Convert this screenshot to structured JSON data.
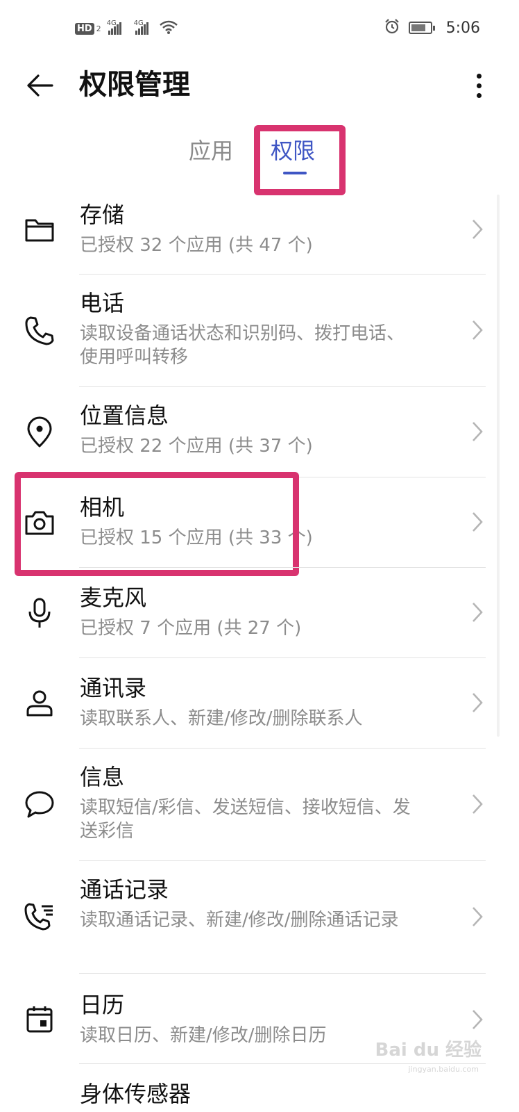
{
  "status_bar": {
    "hd_label": "HD",
    "hd_sub": "2",
    "network1": "4G",
    "network2": "4G",
    "time": "5:06"
  },
  "app_bar": {
    "title": "权限管理"
  },
  "tabs": [
    {
      "label": "应用",
      "selected": false
    },
    {
      "label": "权限",
      "selected": true
    }
  ],
  "accent_color": "#3f56c4",
  "highlight_color": "#d8336f",
  "permissions": [
    {
      "title": "存储",
      "subtitle": "已授权 32 个应用 (共 47 个)",
      "icon": "folder-icon"
    },
    {
      "title": "电话",
      "subtitle": "读取设备通话状态和识别码、拨打电话、使用呼叫转移",
      "icon": "phone-icon"
    },
    {
      "title": "位置信息",
      "subtitle": "已授权 22 个应用 (共 37 个)",
      "icon": "location-pin-icon"
    },
    {
      "title": "相机",
      "subtitle": "已授权 15 个应用 (共 33 个)",
      "icon": "camera-icon"
    },
    {
      "title": "麦克风",
      "subtitle": "已授权 7 个应用 (共 27 个)",
      "icon": "microphone-icon"
    },
    {
      "title": "通讯录",
      "subtitle": "读取联系人、新建/修改/删除联系人",
      "icon": "person-icon"
    },
    {
      "title": "信息",
      "subtitle": "读取短信/彩信、发送短信、接收短信、发送彩信",
      "icon": "chat-bubble-icon"
    },
    {
      "title": "通话记录",
      "subtitle": "读取通话记录、新建/修改/删除通话记录",
      "icon": "call-log-icon"
    },
    {
      "title": "日历",
      "subtitle": "读取日历、新建/修改/删除日历",
      "icon": "calendar-icon"
    },
    {
      "title": "身体传感器",
      "subtitle": "",
      "icon": "body-sensor-icon"
    }
  ],
  "watermark": {
    "text": "Bai du 经验",
    "sub": "jingyan.baidu.com"
  }
}
